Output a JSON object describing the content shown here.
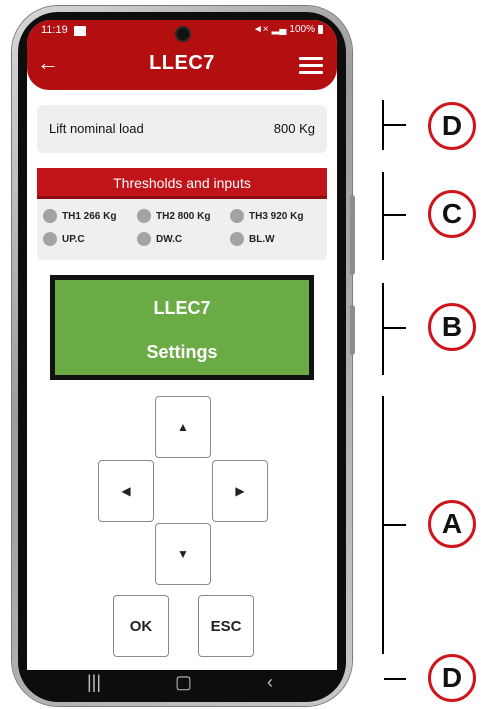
{
  "status_bar": {
    "time": "11:19",
    "right_text": "100%"
  },
  "header": {
    "title": "LLEC7",
    "back_icon": "back-arrow-icon",
    "menu_icon": "hamburger-menu-icon",
    "color": "#b30e10"
  },
  "load": {
    "label": "Lift nominal load",
    "value": "800 Kg"
  },
  "thresholds": {
    "title": "Thresholds and inputs",
    "indicators": [
      {
        "label": "TH1 266 Kg"
      },
      {
        "label": "TH2 800 Kg"
      },
      {
        "label": "TH3 920 Kg"
      },
      {
        "label": "UP.C"
      },
      {
        "label": "DW.C"
      },
      {
        "label": "BL.W"
      }
    ],
    "led_color": "#a3a3a3"
  },
  "display": {
    "line1": "LLEC7",
    "line2": "Settings",
    "color": "#6aab45"
  },
  "keypad": {
    "up_icon": "arrow-up-icon",
    "left_icon": "arrow-left-icon",
    "right_icon": "arrow-right-icon",
    "down_icon": "arrow-down-icon",
    "ok_label": "OK",
    "esc_label": "ESC"
  },
  "navbar": {
    "recents_icon": "recents-icon",
    "home_icon": "home-icon",
    "back_icon": "back-icon"
  },
  "callouts": [
    "D",
    "C",
    "B",
    "A",
    "D"
  ]
}
